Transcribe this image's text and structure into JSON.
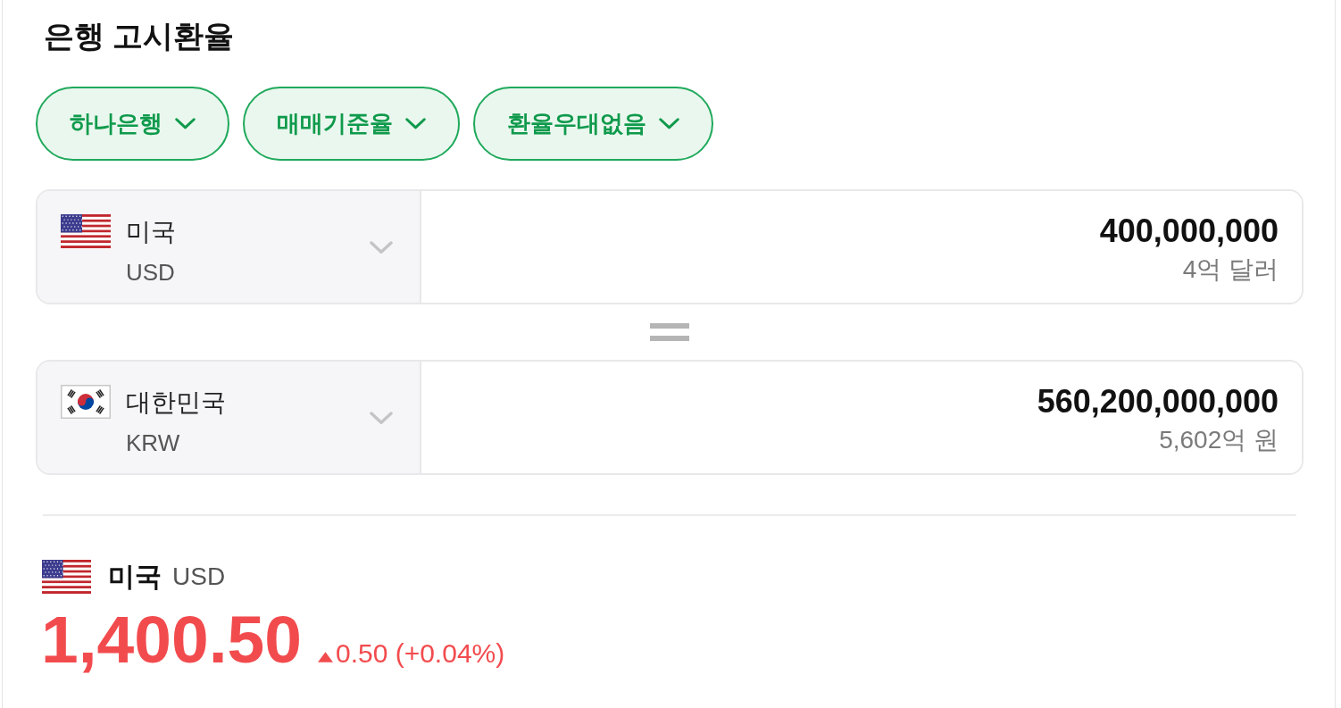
{
  "title": "은행 고시환율",
  "filters": [
    {
      "label": "하나은행"
    },
    {
      "label": "매매기준율"
    },
    {
      "label": "환율우대없음"
    }
  ],
  "converter": [
    {
      "kind": "us",
      "country": "미국",
      "currency": "USD",
      "amount": "400,000,000",
      "amount_words": "4억 달러"
    },
    {
      "kind": "kr",
      "country": "대한민국",
      "currency": "KRW",
      "amount": "560,200,000,000",
      "amount_words": "5,602억 원"
    }
  ],
  "rate": {
    "kind": "us",
    "country": "미국",
    "currency": "USD",
    "value": "1,400.50",
    "rising": true,
    "change": "0.50 (+0.04%)"
  }
}
